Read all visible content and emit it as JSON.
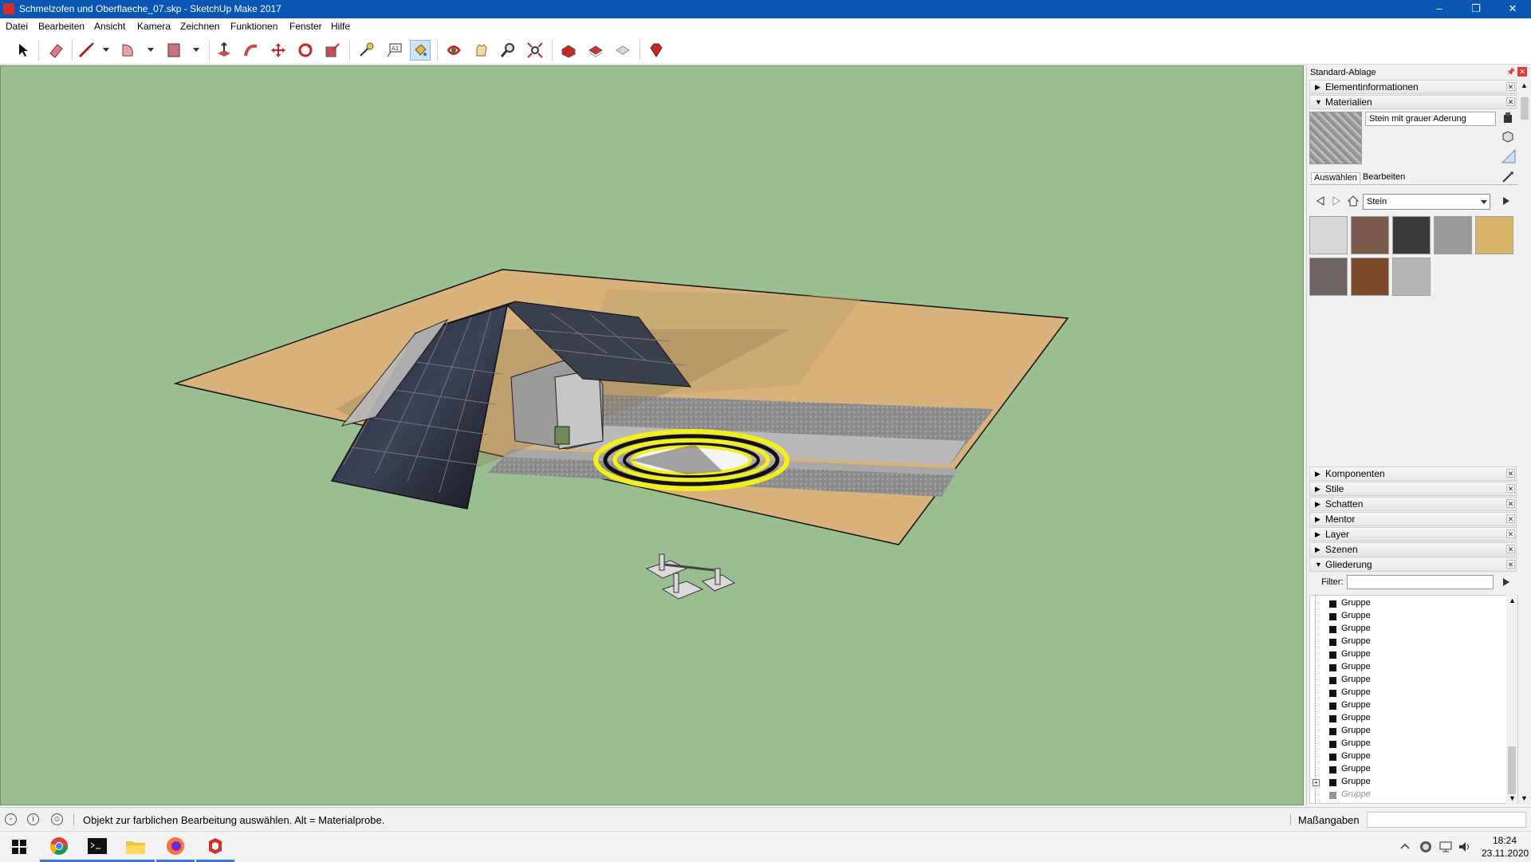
{
  "window": {
    "title": "Schmelzofen und Oberflaeche_07.skp - SketchUp Make 2017",
    "minimize": "–",
    "maximize": "❐",
    "close": "✕"
  },
  "menu": [
    "Datei",
    "Bearbeiten",
    "Ansicht",
    "Kamera",
    "Zeichnen",
    "Funktionen",
    "Fenster",
    "Hilfe"
  ],
  "tray": {
    "title": "Standard-Ablage",
    "sections_top": [
      {
        "label": "Elementinformationen",
        "expanded": false
      },
      {
        "label": "Materialien",
        "expanded": true
      }
    ],
    "materials": {
      "current_name": "Stein mit grauer Aderung",
      "tab_select": "Auswählen",
      "tab_edit": "Bearbeiten",
      "collection": "Stein",
      "swatches": [
        "#d8d8d8",
        "#7a5a4a",
        "#3b3b3b",
        "#9a9a9a",
        "#d9b56c",
        "#6e6564",
        "#7a4a2a",
        "#b5b5b5"
      ]
    },
    "sections_bottom": [
      {
        "label": "Komponenten",
        "expanded": false
      },
      {
        "label": "Stile",
        "expanded": false
      },
      {
        "label": "Schatten",
        "expanded": false
      },
      {
        "label": "Mentor",
        "expanded": false
      },
      {
        "label": "Layer",
        "expanded": false
      },
      {
        "label": "Szenen",
        "expanded": false
      },
      {
        "label": "Gliederung",
        "expanded": true
      }
    ],
    "outline": {
      "filter_label": "Filter:",
      "filter_value": "",
      "items": [
        "Gruppe",
        "Gruppe",
        "Gruppe",
        "Gruppe",
        "Gruppe",
        "Gruppe",
        "Gruppe",
        "Gruppe",
        "Gruppe",
        "Gruppe",
        "Gruppe",
        "Gruppe",
        "Gruppe",
        "Gruppe",
        "Gruppe",
        "Gruppe",
        "Gruppe"
      ]
    }
  },
  "status": {
    "message": "Objekt zur farblichen Bearbeitung auswählen. Alt = Materialprobe.",
    "measurements_label": "Maßangaben",
    "measurements_value": ""
  },
  "taskbar": {
    "time": "18:24",
    "date": "23.11.2020"
  },
  "colors": {
    "titlebar": "#0a56b4",
    "viewport_bg": "#9abe8f",
    "ground": "#d8b27a",
    "road": "#8c8c8c",
    "selection": "#f2ee1c"
  }
}
